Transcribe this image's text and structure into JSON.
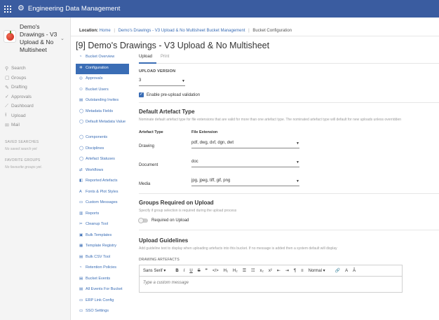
{
  "app": {
    "title": "Engineering Data Management"
  },
  "project": {
    "name": "Demo's Drawings - V3 Upload & No Multisheet"
  },
  "sidebar": {
    "items": [
      {
        "icon": "⚲",
        "label": "Search"
      },
      {
        "icon": "▢",
        "label": "Groups"
      },
      {
        "icon": "✎",
        "label": "Drafting"
      },
      {
        "icon": "✓",
        "label": "Approvals"
      },
      {
        "icon": "⟋",
        "label": "Dashboard"
      },
      {
        "icon": "⭱",
        "label": "Upload"
      },
      {
        "icon": "✉",
        "label": "Mail"
      }
    ],
    "saved_searches_heading": "SAVED SEARCHES",
    "saved_searches_empty": "No saved search yet",
    "favorite_groups_heading": "FAVORITE GROUPS",
    "favorite_groups_empty": "No favourite groups yet."
  },
  "breadcrumb": {
    "prefix": "Location:",
    "home": "Home",
    "project": "Demo's Drawings - V3 Upload & No Multisheet Bucket Management",
    "current": "Bucket Configuration"
  },
  "page_title": "[9] Demo's Drawings - V3 Upload & No Multisheet",
  "left_nav": [
    {
      "icon": "◔",
      "label": "Bucket Overview"
    },
    {
      "icon": "✲",
      "label": "Configuration",
      "active": true
    },
    {
      "icon": "◎",
      "label": "Approvals"
    },
    {
      "icon": "⚇",
      "label": "Bucket Users"
    },
    {
      "icon": "▤",
      "label": "Outstanding Invites"
    },
    {
      "icon": "◯",
      "label": "Metadata Fields"
    },
    {
      "icon": "◯",
      "label": "Default Metadata Value",
      "two": true
    },
    {
      "icon": "◯",
      "label": "Components"
    },
    {
      "icon": "◯",
      "label": "Disciplines"
    },
    {
      "icon": "◯",
      "label": "Artefact Statuses"
    },
    {
      "icon": "⇄",
      "label": "Workflows"
    },
    {
      "icon": "◧",
      "label": "Reported Artefacts"
    },
    {
      "icon": "A",
      "label": "Fonts & Plot Styles"
    },
    {
      "icon": "▭",
      "label": "Custom Messages"
    },
    {
      "icon": "▥",
      "label": "Reports"
    },
    {
      "icon": "✂",
      "label": "Cleanup Tool"
    },
    {
      "icon": "▣",
      "label": "Bulk Templates"
    },
    {
      "icon": "▦",
      "label": "Template Registry"
    },
    {
      "icon": "▤",
      "label": "Bulk CSV Tool"
    },
    {
      "icon": "◔",
      "label": "Retention Policies"
    },
    {
      "icon": "▤",
      "label": "Bucket Events"
    },
    {
      "icon": "▤",
      "label": "All Events For Bucket"
    },
    {
      "icon": "▭",
      "label": "ERP Link Config"
    },
    {
      "icon": "▭",
      "label": "SSO Settings"
    }
  ],
  "tabs": [
    {
      "label": "Upload",
      "active": true
    },
    {
      "label": "Print"
    }
  ],
  "upload_version": {
    "label": "UPLOAD VERSION",
    "value": "3"
  },
  "pre_upload_validation": {
    "label": "Enable pre-upload validation",
    "checked": true
  },
  "default_artefact": {
    "title": "Default Artefact Type",
    "description": "Nominate default artefact type for file extensions that are valid for more than one artefact type. The nominated artefact type will default for new uploads unless overridden",
    "col_type": "Artefact Type",
    "col_ext": "File Extension",
    "rows": [
      {
        "type": "Drawing",
        "ext": "pdf, dwg, dxf, dgn, dwt"
      },
      {
        "type": "Document",
        "ext": "doc"
      },
      {
        "type": "Media",
        "ext": "jpg, jpeg, tiff, gif, png"
      }
    ]
  },
  "groups_required": {
    "title": "Groups Required on Upload",
    "description": "Specify if group selection is required during the upload process",
    "toggle_label": "Required on Upload",
    "on": false
  },
  "guidelines": {
    "title": "Upload Guidelines",
    "description": "Add guideline text to display when uploading artefacts into this bucket. If no message is added then a system default will display",
    "sub_label": "DRAWING ARTEFACTS",
    "toolbar": [
      "Sans Serif ▾",
      "B",
      "I",
      "U",
      "S",
      "❞",
      "</>",
      "H₁",
      "H₂",
      "☰",
      "☷",
      "x₂",
      "x²",
      "⇤",
      "⇥",
      "¶",
      "≡",
      "Normal ▾",
      "🔗",
      "A",
      "Ā"
    ],
    "placeholder": "Type a custom message"
  }
}
